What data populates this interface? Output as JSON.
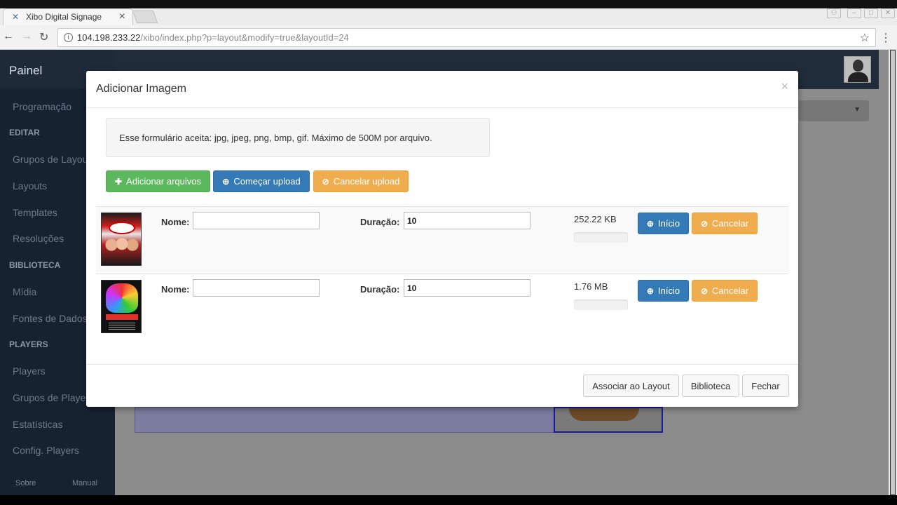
{
  "browser": {
    "tab_title": "Xibo Digital Signage",
    "tab_close": "×",
    "url_host": "104.198.233.22",
    "url_path": "/xibo/index.php?p=layout&modify=true&layoutId=24"
  },
  "sidebar": {
    "brand": "Painel",
    "items": [
      {
        "type": "item",
        "label": "Programação"
      },
      {
        "type": "header",
        "label": "EDITAR"
      },
      {
        "type": "item",
        "label": "Grupos de Layout"
      },
      {
        "type": "item",
        "label": "Layouts"
      },
      {
        "type": "item",
        "label": "Templates"
      },
      {
        "type": "item",
        "label": "Resoluções"
      },
      {
        "type": "header",
        "label": "BIBLIOTECA"
      },
      {
        "type": "item",
        "label": "Mídia"
      },
      {
        "type": "item",
        "label": "Fontes de Dados"
      },
      {
        "type": "header",
        "label": "PLAYERS"
      },
      {
        "type": "item",
        "label": "Players"
      },
      {
        "type": "item",
        "label": "Grupos de Players"
      },
      {
        "type": "item",
        "label": "Estatísticas"
      },
      {
        "type": "item",
        "label": "Config. Players"
      }
    ],
    "footer": {
      "about": "Sobre",
      "manual": "Manual"
    }
  },
  "modal": {
    "title": "Adicionar Imagem",
    "close": "×",
    "info_text": "Esse formulário aceita: jpg, jpeg, png, bmp, gif. Máximo de 500M por arquivo.",
    "toolbar": {
      "add_files": "Adicionar arquivos",
      "start_upload": "Começar upload",
      "cancel_upload": "Cancelar upload"
    },
    "files": [
      {
        "name_label": "Nome:",
        "name_value": "",
        "duration_label": "Duração:",
        "duration_value": "10",
        "size": "252.22 KB",
        "progress": 0,
        "start_label": "Início",
        "cancel_label": "Cancelar"
      },
      {
        "name_label": "Nome:",
        "name_value": "",
        "duration_label": "Duração:",
        "duration_value": "10",
        "size": "1.76 MB",
        "progress": 0,
        "start_label": "Início",
        "cancel_label": "Cancelar"
      }
    ],
    "footer": {
      "assign": "Associar ao Layout",
      "library": "Biblioteca",
      "close": "Fechar"
    }
  },
  "colors": {
    "success": "#5cb85c",
    "primary": "#337ab7",
    "warning": "#f0ad4e",
    "sidebar_bg": "#162230"
  }
}
